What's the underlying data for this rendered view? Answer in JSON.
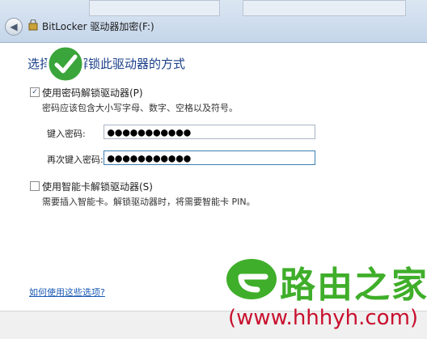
{
  "window": {
    "title": "BitLocker 驱动器加密(F:)"
  },
  "main": {
    "heading": "选择希望解锁此驱动器的方式",
    "options": [
      {
        "label": "使用密码解锁驱动器(P)",
        "checked": true,
        "hint": "密码应该包含大小写字母、数字、空格以及符号。"
      },
      {
        "label": "使用智能卡解锁驱动器(S)",
        "checked": false,
        "hint": "需要插入智能卡。解锁驱动器时，将需要智能卡 PIN。"
      }
    ],
    "password_label": "键入密码:",
    "password_value": "●●●●●●●●●●●",
    "confirm_label": "再次键入密码:",
    "confirm_value": "●●●●●●●●●●●",
    "help_link": "如何使用这些选项?"
  },
  "watermark": {
    "brand": "路由之家",
    "url": "(www.hhhyh.com)",
    "brand_color": "#3fae2a",
    "url_color": "#c8102e"
  },
  "icons": {
    "back": "back-arrow-icon",
    "app": "bitlocker-icon",
    "check_badge": "checkmark-badge-icon"
  }
}
